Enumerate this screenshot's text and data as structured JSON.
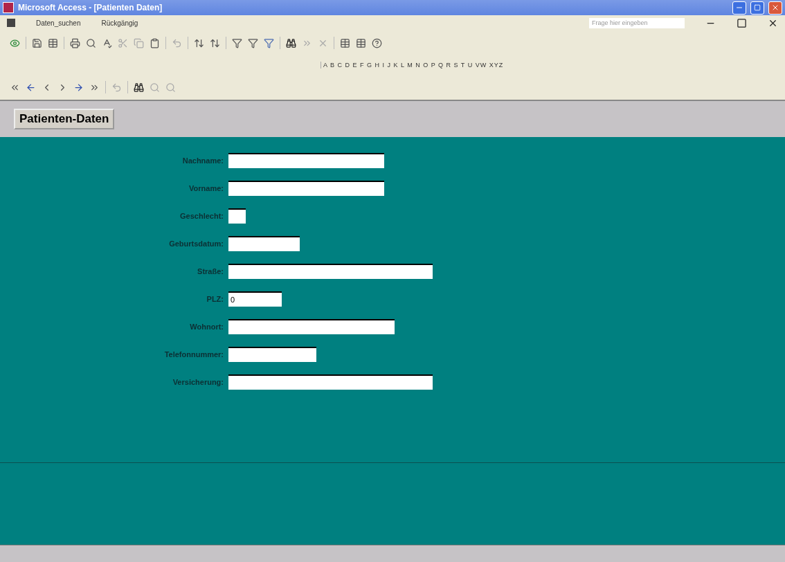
{
  "window": {
    "title": "Microsoft Access - [Patienten Daten]"
  },
  "menu": [
    "Daten_suchen",
    "Rückgängig"
  ],
  "help_box": {
    "placeholder": "Frage hier eingeben"
  },
  "alphabet": "A B C D E F G H I J K L M N O P Q R S T U VW XYZ",
  "form_header": {
    "button": "Patienten-Daten"
  },
  "fields": [
    {
      "label": "Nachname:"
    },
    {
      "label": "Vorname:"
    },
    {
      "label": "Geschlecht:"
    },
    {
      "label": "Geburtsdatum:"
    },
    {
      "label": "Straße:"
    },
    {
      "label": "PLZ:",
      "value": "0"
    },
    {
      "label": "Wohnort:"
    },
    {
      "label": "Telefonnummer:"
    },
    {
      "label": "Versicherung:"
    }
  ]
}
